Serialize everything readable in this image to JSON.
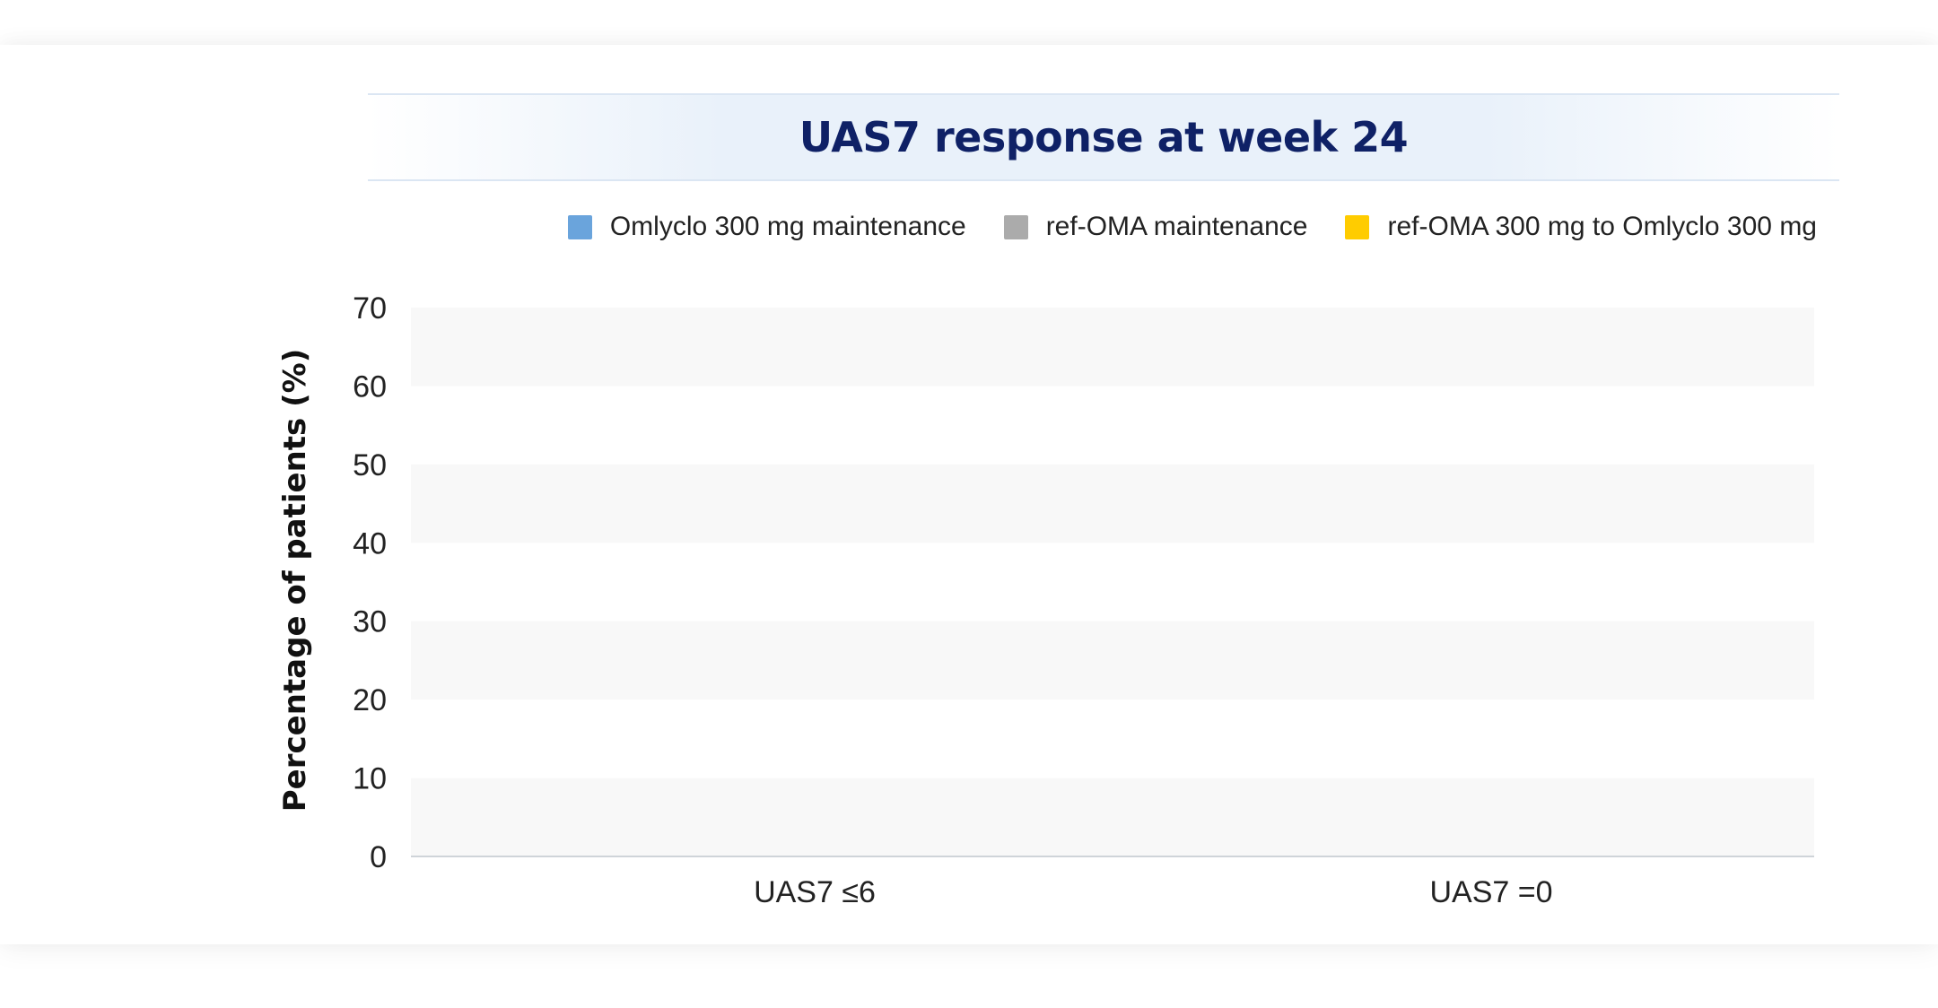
{
  "chart_data": {
    "type": "bar",
    "title": "UAS7 response at week 24",
    "categories": [
      "UAS7 ≤6",
      "UAS7 =0"
    ],
    "series": [
      {
        "name": "Omlyclo 300 mg maintenance",
        "color": "#6aa4dc",
        "values": [
          null,
          null
        ]
      },
      {
        "name": "ref-OMA maintenance",
        "color": "#ababab",
        "values": [
          null,
          null
        ]
      },
      {
        "name": "ref-OMA 300 mg to Omlyclo 300 mg",
        "color": "#ffcc00",
        "values": [
          null,
          null
        ]
      }
    ],
    "ylabel": "Percentage of patients (%)",
    "xlabel": "",
    "ylim": [
      0,
      70
    ],
    "yticks": [
      "0",
      "10",
      "20",
      "30",
      "40",
      "50",
      "60",
      "70"
    ],
    "grid": "alternating horizontal bands",
    "legend_position": "top-right"
  }
}
